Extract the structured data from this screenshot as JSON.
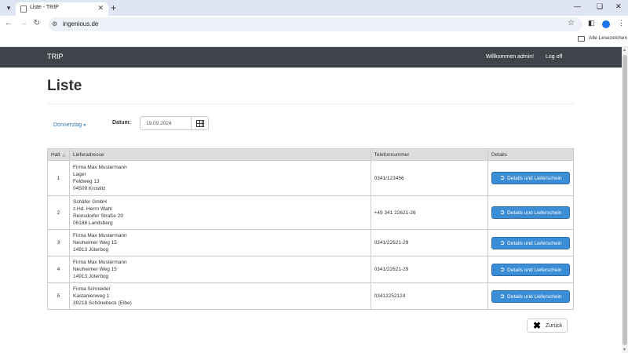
{
  "browser": {
    "tab_title": "Liste - TRIP",
    "url": "ingenious.de",
    "bookmarks_label": "Alle Lesezeichen"
  },
  "navbar": {
    "brand": "TRIP",
    "welcome": "Willkommen admin!",
    "logoff": "Log off"
  },
  "page": {
    "heading": "Liste",
    "day_dropdown": "Donnerstag",
    "date_label": "Datum:",
    "date_value": "19.09.2024",
    "back_label": "Zurück"
  },
  "table": {
    "headers": [
      "Halt",
      "Lieferadresse",
      "Telefonnummer",
      "Details"
    ],
    "rows": [
      {
        "halt": "1",
        "address": [
          "Firma Max Mustermann",
          "Lager",
          "Feldweg 13",
          "04509 Krostitz"
        ],
        "phone": "0341/123456",
        "button": "Details und Lieferschein"
      },
      {
        "halt": "2",
        "address": [
          "Schäfer GmbH",
          "z.Hd. Herrn Wahl",
          "Reinsdorfer Straße 20",
          "06188 Landsberg"
        ],
        "phone": "+49 341 22621-26",
        "button": "Details und Lieferschein"
      },
      {
        "halt": "3",
        "address": [
          "Firma Max Mustermann",
          "Neuheimer Weg 15",
          "14913 Jüterbog"
        ],
        "phone": "0341/22621-29",
        "button": "Details und Lieferschein"
      },
      {
        "halt": "4",
        "address": [
          "Firma Max Mustermann",
          "Neuheimer Weg 15",
          "14913 Jüterbog"
        ],
        "phone": "0341/22621-29",
        "button": "Details und Lieferschein"
      },
      {
        "halt": "5",
        "address": [
          "Firma Schneider",
          "Kastanienweg 1",
          "39218 Schönebeck (Elbe)"
        ],
        "phone": "03412252124",
        "button": "Details und Lieferschein"
      }
    ]
  },
  "colors": {
    "navbar": "#3f434a",
    "link": "#337ab7",
    "primary_button": "#3b8dd6"
  }
}
